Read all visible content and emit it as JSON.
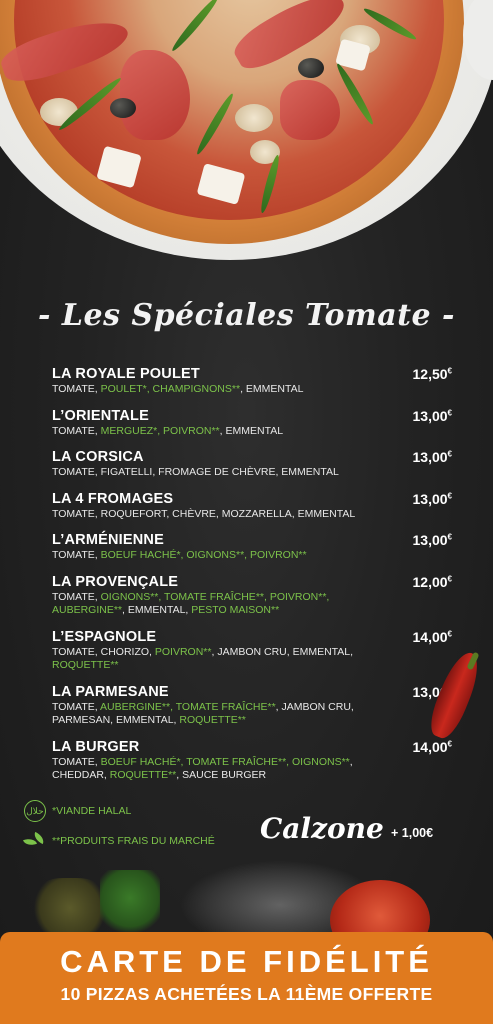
{
  "title": "- Les Spéciales Tomate -",
  "menu": [
    {
      "name": "LA ROYALE POULET",
      "price": "12,50",
      "ingredients": [
        {
          "t": "TOMATE, ",
          "g": false
        },
        {
          "t": "POULET*, CHAMPIGNONS**",
          "g": true
        },
        {
          "t": ", EMMENTAL",
          "g": false
        }
      ]
    },
    {
      "name": "L’ORIENTALE",
      "price": "13,00",
      "ingredients": [
        {
          "t": "TOMATE, ",
          "g": false
        },
        {
          "t": "MERGUEZ*, POIVRON**",
          "g": true
        },
        {
          "t": ", EMMENTAL",
          "g": false
        }
      ]
    },
    {
      "name": "LA CORSICA",
      "price": "13,00",
      "ingredients": [
        {
          "t": "TOMATE, FIGATELLI, FROMAGE DE CHÈVRE, EMMENTAL",
          "g": false
        }
      ]
    },
    {
      "name": "LA 4 FROMAGES",
      "price": "13,00",
      "ingredients": [
        {
          "t": "TOMATE, ROQUEFORT, CHÈVRE, MOZZARELLA, EMMENTAL",
          "g": false
        }
      ]
    },
    {
      "name": "L’ARMÉNIENNE",
      "price": "13,00",
      "ingredients": [
        {
          "t": "TOMATE, ",
          "g": false
        },
        {
          "t": "BOEUF HACHÉ*, OIGNONS**, POIVRON**",
          "g": true
        }
      ]
    },
    {
      "name": "LA PROVENÇALE",
      "price": "12,00",
      "ingredients": [
        {
          "t": "TOMATE, ",
          "g": false
        },
        {
          "t": "OIGNONS**, TOMATE FRAÎCHE**, POIVRON**, AUBERGINE**",
          "g": true
        },
        {
          "t": ", EMMENTAL, ",
          "g": false
        },
        {
          "t": "PESTO MAISON**",
          "g": true
        }
      ]
    },
    {
      "name": "L’ESPAGNOLE",
      "price": "14,00",
      "ingredients": [
        {
          "t": "TOMATE, CHORIZO, ",
          "g": false
        },
        {
          "t": "POIVRON**",
          "g": true
        },
        {
          "t": ", JAMBON CRU, EMMENTAL, ",
          "g": false
        },
        {
          "t": "ROQUETTE**",
          "g": true
        }
      ]
    },
    {
      "name": "LA PARMESANE",
      "price": "13,00",
      "ingredients": [
        {
          "t": "TOMATE, ",
          "g": false
        },
        {
          "t": "AUBERGINE**, TOMATE FRAÎCHE**",
          "g": true
        },
        {
          "t": ", JAMBON CRU, PARMESAN, EMMENTAL, ",
          "g": false
        },
        {
          "t": "ROQUETTE**",
          "g": true
        }
      ]
    },
    {
      "name": "LA BURGER",
      "price": "14,00",
      "ingredients": [
        {
          "t": "TOMATE, ",
          "g": false
        },
        {
          "t": "BOEUF HACHÉ*, TOMATE FRAÎCHE**, OIGNONS**",
          "g": true
        },
        {
          "t": ", CHEDDAR, ",
          "g": false
        },
        {
          "t": "ROQUETTE**",
          "g": true
        },
        {
          "t": ", SAUCE BURGER",
          "g": false
        }
      ]
    }
  ],
  "currency": "€",
  "legend": {
    "halal_icon": "حلال",
    "halal": "*VIANDE HALAL",
    "fresh": "**PRODUITS FRAIS DU MARCHÉ"
  },
  "calzone": {
    "label": "Calzone",
    "price": "+ 1,00€"
  },
  "footer": {
    "title": "CARTE DE FIDÉLITÉ",
    "subtitle": "10 PIZZAS ACHETÉES LA 11ÈME OFFERTE"
  },
  "colors": {
    "accent_green": "#7cc24a",
    "footer_orange": "#e07a1e",
    "background": "#232323"
  }
}
